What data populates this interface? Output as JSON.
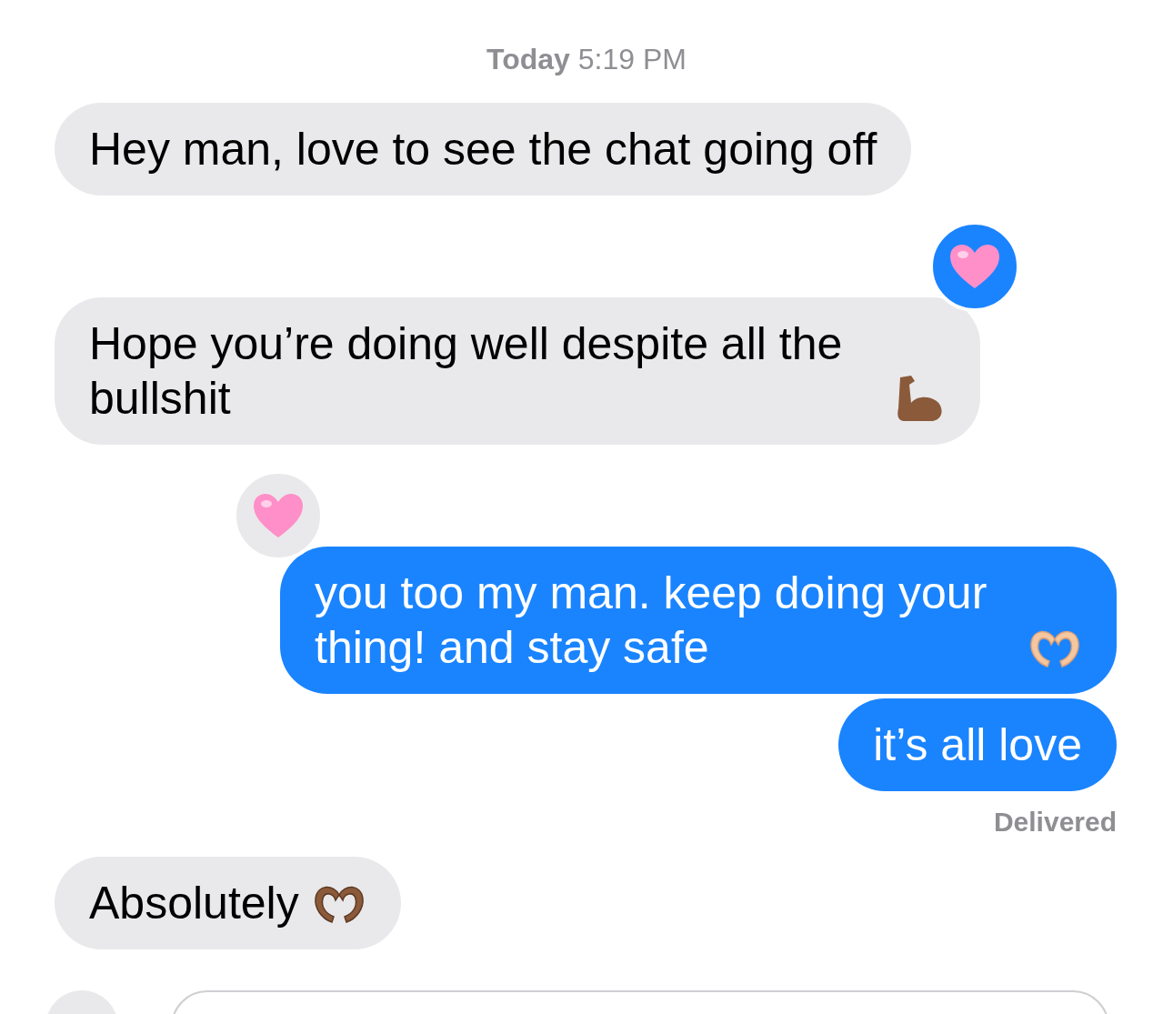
{
  "timestamp": "**Today** 5:19 PM",
  "messages": [
    {
      "kind": "received",
      "text": "Hey man, love to see the chat going off"
    },
    {
      "kind": "received",
      "text": "Hope you’re doing well despite all the bullshit",
      "trailing_icon": {
        "kind": "flexed-arm"
      },
      "tapback": {
        "kind": "heart"
      }
    },
    {
      "kind": "sent",
      "text": "you too my man. keep doing your thing! and stay safe",
      "trailing_icon": {
        "kind": "heart-hands-light"
      },
      "tapback": {
        "kind": "heart"
      }
    },
    {
      "kind": "sent",
      "text": "it’s all love",
      "status": "Delivered"
    },
    {
      "kind": "received",
      "text": "Absolutely",
      "trailing_icon": {
        "kind": "heart-hands-dark"
      }
    }
  ],
  "composer": {
    "kind": "field"
  }
}
